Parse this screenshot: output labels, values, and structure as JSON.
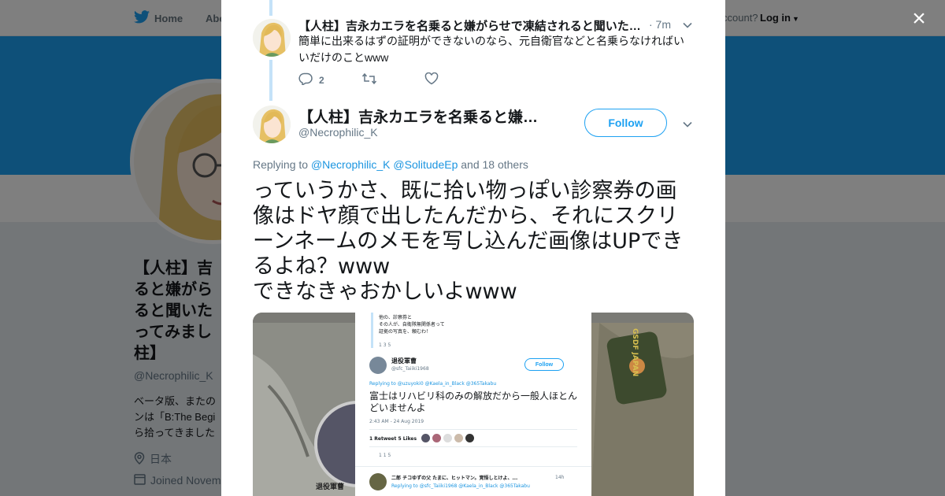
{
  "nav": {
    "home_label": "Home",
    "about_label": "Abo",
    "account_label": "ccount?",
    "login_label": "Log in"
  },
  "profile": {
    "name": "【人柱】吉永カエラを名乗ると嫌がらせで凍結されると聞いたのでやってみました【人柱】",
    "name_visible": "【人柱】吉\nると嫌がら\nると聞いた\nってみまし\n柱】",
    "handle": "@Necrophilic_K",
    "bio_visible": "ベータ版、またの\nンは「B:The Begi\nら拾ってきました",
    "location": "日本",
    "joined": "Joined Novem"
  },
  "modal": {
    "close_label": "×",
    "previous_reply": {
      "name": "【人柱】吉永カエラを名乗ると嫌がらせで凍結されると聞いたのでやってみました【人柱】",
      "time": "· 7m",
      "text": "簡単に出来るはずの証明ができないのなら、元自衛官などと名乗らなければいいだけのことwww",
      "reply_count": "2",
      "retweet_count": "",
      "like_count": ""
    },
    "tweet": {
      "name": "【人柱】吉永カエラを名乗ると嫌がらせで凍結されると聞いたのでやってみました【人柱】",
      "handle": "@Necrophilic_K",
      "follow_label": "Follow",
      "replying_prefix": "Replying to",
      "replying_user1": "@Necrophilic_K",
      "replying_user2": "@SolitudeEp",
      "replying_suffix": "and 18 others",
      "text": "っていうかさ、既に拾い物っぽい診察券の画像はドヤ顔で出したんだから、それにスクリーンネームのメモを写し込んだ画像はUPできるよね？www\nできなきゃおかしいよwww"
    },
    "media": {
      "top_lines": "他の、診察券と\nその人が、自衛隊無関係者って\n証拠の写真を、頼むわ！",
      "top_counts": "1   3   5",
      "user_name": "退役軍曹",
      "user_handle": "@sfc_Taiiki1968",
      "follow_label": "Follow",
      "replying": "Replying to @uzuyoki0 @Kaela_in_Black @365Takabu",
      "text": "富士はリハビリ科のみの解放だから一般人ほとんどいませんよ",
      "timestamp": "2:43 AM - 24 Aug 2019",
      "stats": "1 Retweet  5 Likes",
      "counts": "1   1   5",
      "next_name": "二郎 チコゆずの父 たまに、ヒットマン。覚悟しとけよ、...",
      "next_time": "14h",
      "next_replying": "Replying to @sfc_Taiiki1968 @Kaela_in_Black @365Takabu",
      "side_name": "退役軍曹",
      "patch_text": "GSDF JAPAN"
    }
  },
  "colors": {
    "twitter_blue": "#1da1f2",
    "thread_line": "#c4e2f8",
    "link": "#1b95e0",
    "secondary_text": "#657786"
  }
}
